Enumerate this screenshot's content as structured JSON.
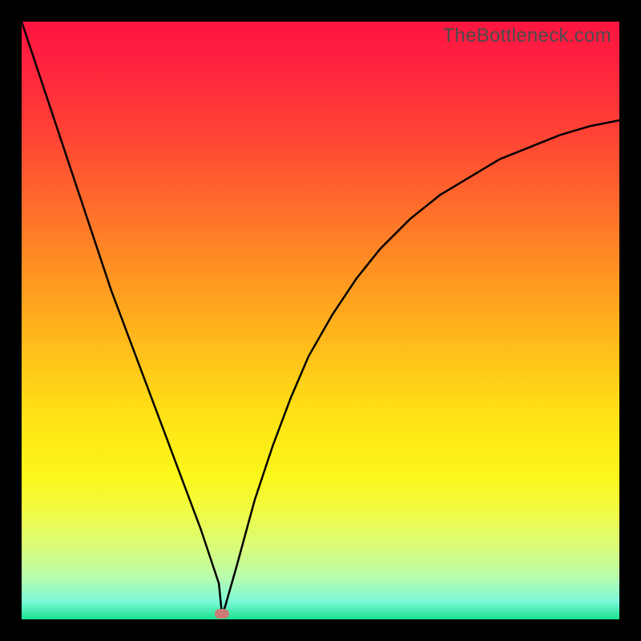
{
  "watermark": "TheBottleneck.com",
  "chart_data": {
    "type": "line",
    "title": "",
    "xlabel": "",
    "ylabel": "",
    "xlim": [
      0,
      100
    ],
    "ylim": [
      0,
      100
    ],
    "grid": false,
    "series": [
      {
        "name": "curve",
        "x": [
          0,
          3,
          6,
          9,
          12,
          15,
          18,
          21,
          24,
          27,
          30,
          33,
          33.5,
          34,
          36,
          39,
          42,
          45,
          48,
          52,
          56,
          60,
          65,
          70,
          75,
          80,
          85,
          90,
          95,
          100
        ],
        "values": [
          100,
          91,
          82,
          73,
          64,
          55,
          47,
          39,
          31,
          23,
          15,
          6,
          1,
          2,
          9,
          20,
          29,
          37,
          44,
          51,
          57,
          62,
          67,
          71,
          74,
          77,
          79,
          81,
          82.5,
          83.5
        ]
      }
    ],
    "marker": {
      "x": 33.5,
      "y": 1,
      "color": "#cc7a74"
    },
    "colors": {
      "curve": "#000000",
      "gradient_top": "#ff1540",
      "gradient_bottom": "#1ae28e",
      "frame": "#000000"
    }
  }
}
